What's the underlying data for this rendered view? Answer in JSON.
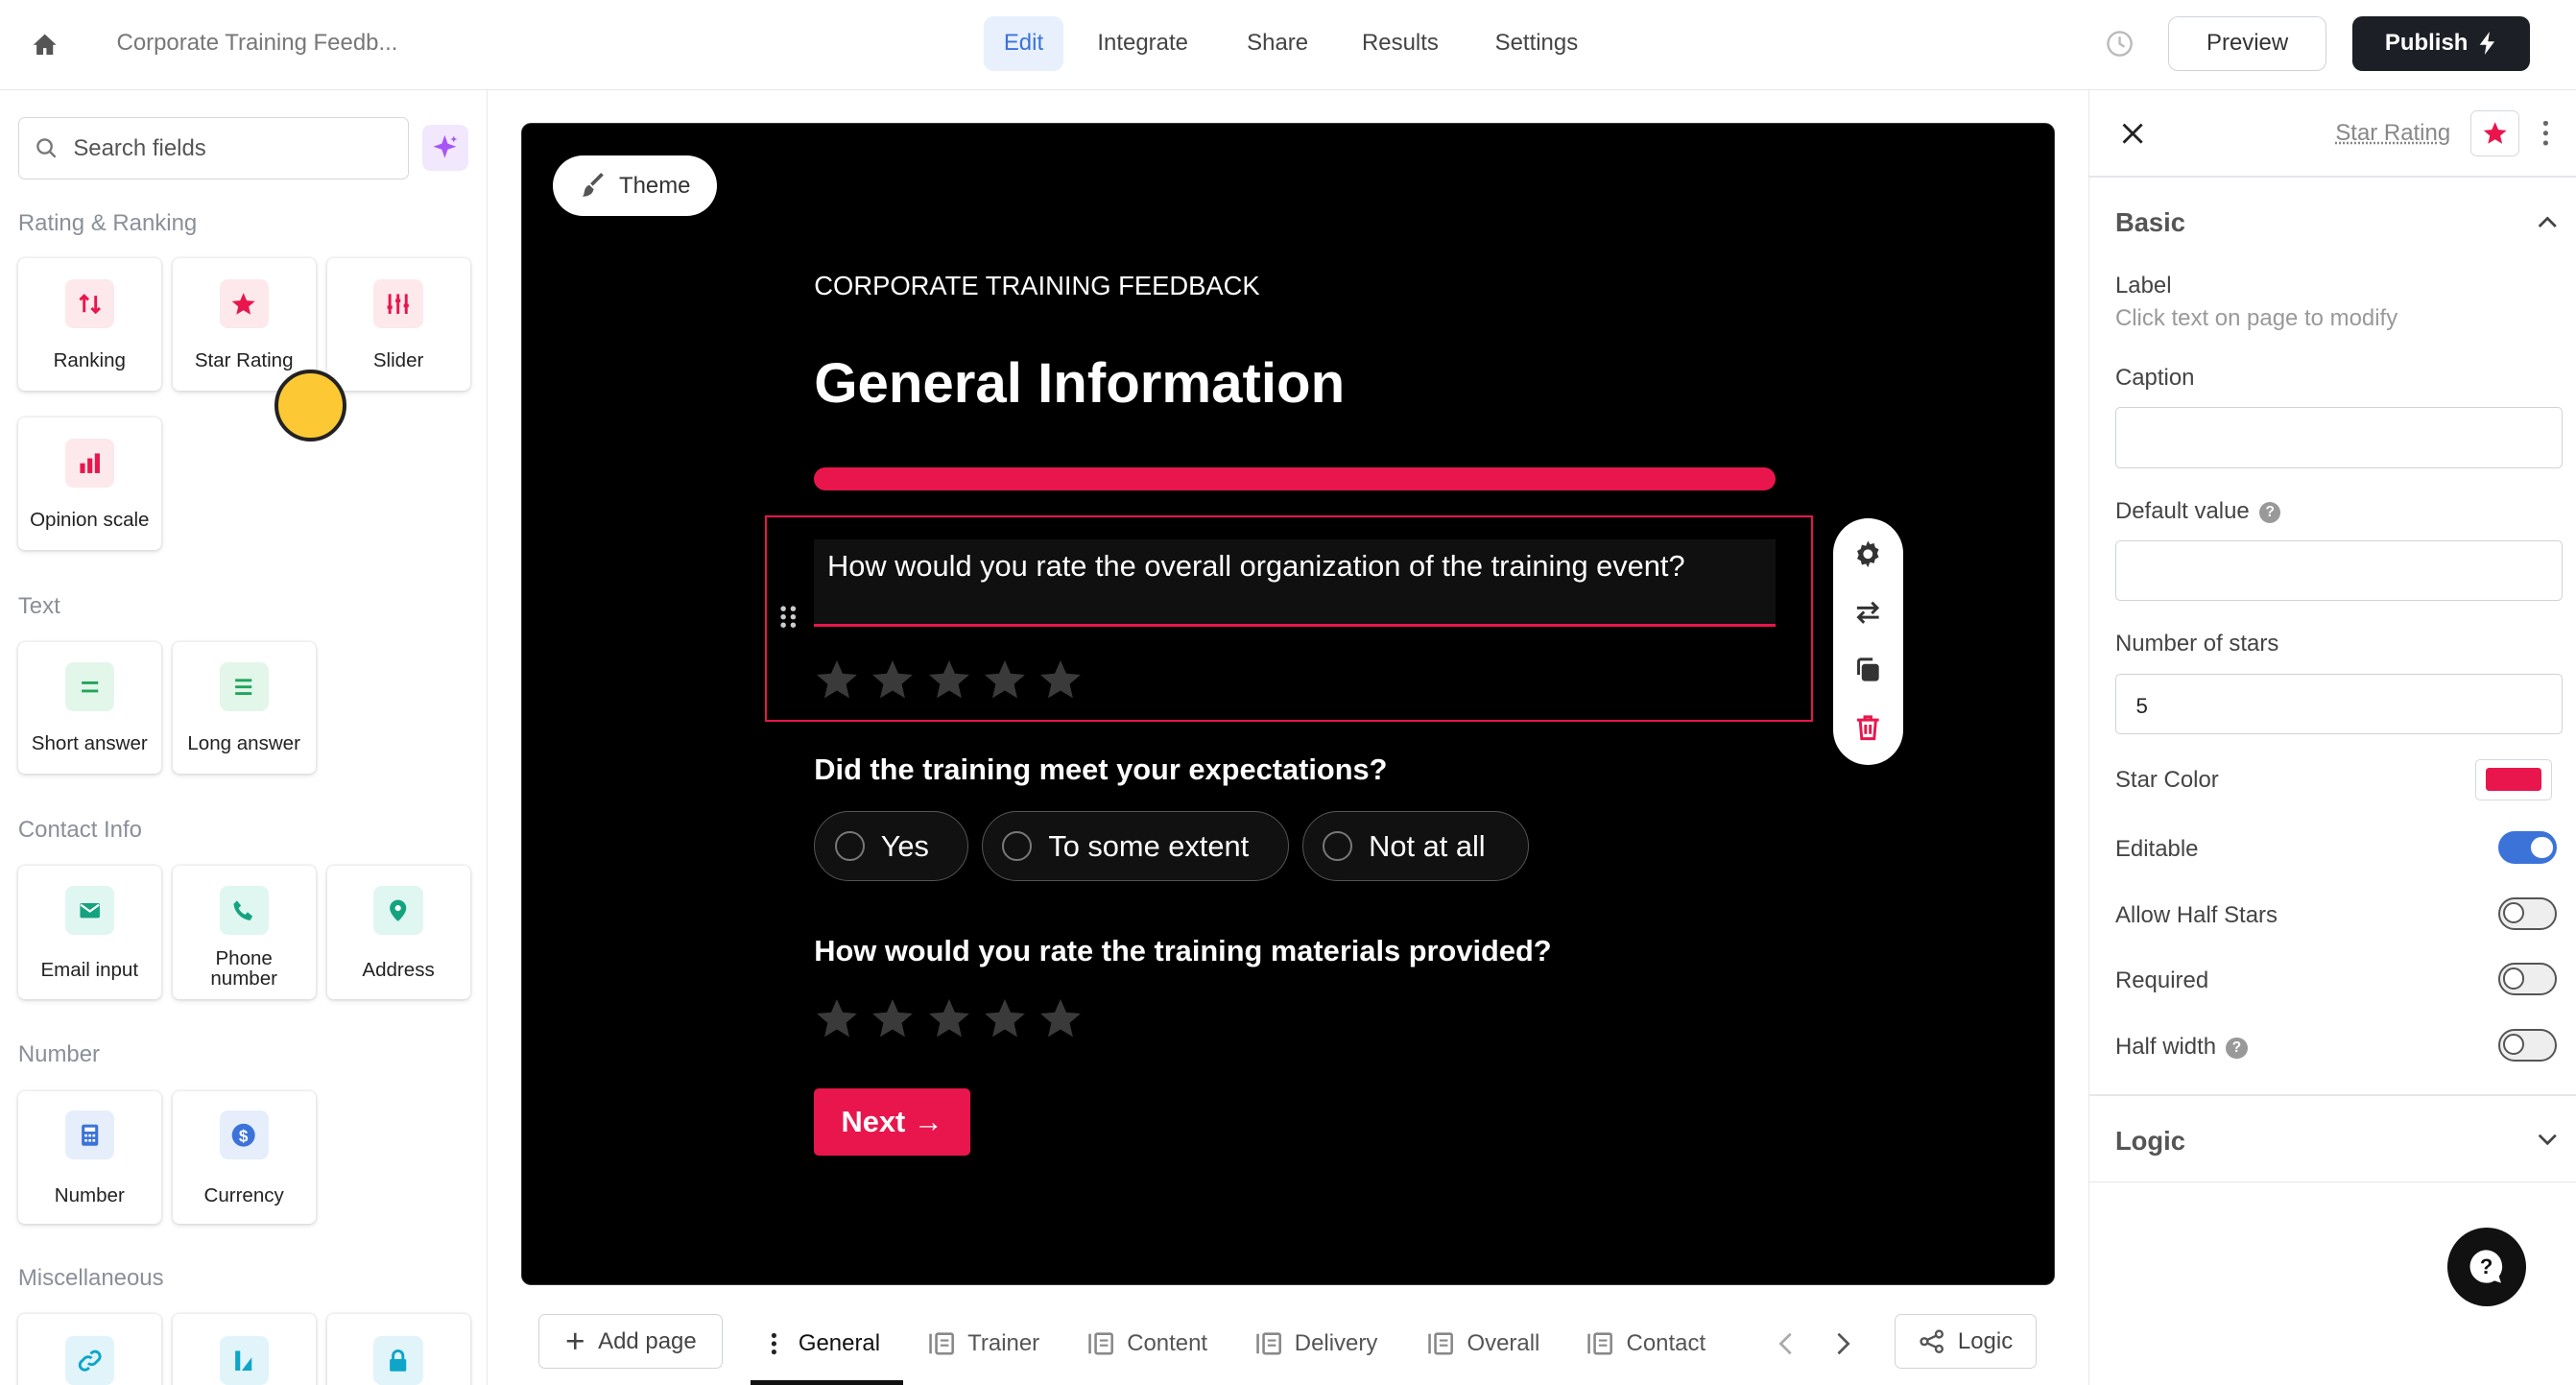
{
  "header": {
    "form_name": "Corporate Training Feedb...",
    "tabs": [
      {
        "label": "Edit",
        "active": true
      },
      {
        "label": "Integrate"
      },
      {
        "label": "Share"
      },
      {
        "label": "Results"
      },
      {
        "label": "Settings"
      }
    ],
    "preview_label": "Preview",
    "publish_label": "Publish"
  },
  "sidebar": {
    "search_placeholder": "Search fields",
    "sections": [
      {
        "title": "Rating & Ranking",
        "items": [
          {
            "label": "Ranking",
            "icon": "ranking-arrows-icon"
          },
          {
            "label": "Star Rating",
            "icon": "star-icon"
          },
          {
            "label": "Slider",
            "icon": "slider-icon"
          },
          {
            "label": "Opinion scale",
            "icon": "bar-chart-icon"
          }
        ]
      },
      {
        "title": "Text",
        "items": [
          {
            "label": "Short answer",
            "icon": "short-text-icon"
          },
          {
            "label": "Long answer",
            "icon": "long-text-icon"
          }
        ]
      },
      {
        "title": "Contact Info",
        "items": [
          {
            "label": "Email input",
            "icon": "email-icon"
          },
          {
            "label": "Phone number",
            "icon": "phone-icon"
          },
          {
            "label": "Address",
            "icon": "location-pin-icon"
          }
        ]
      },
      {
        "title": "Number",
        "items": [
          {
            "label": "Number",
            "icon": "calculator-icon"
          },
          {
            "label": "Currency",
            "icon": "dollar-icon"
          }
        ]
      },
      {
        "title": "Miscellaneous",
        "items": [
          {
            "label": "",
            "icon": "link-icon"
          },
          {
            "label": "",
            "icon": "signature-icon"
          },
          {
            "label": "",
            "icon": "lock-icon"
          }
        ]
      }
    ]
  },
  "canvas": {
    "theme_label": "Theme",
    "form_subtitle": "CORPORATE TRAINING FEEDBACK",
    "page_title": "General Information",
    "progress_fraction": 1.0,
    "questions": [
      {
        "text": "How would you rate the overall organization of the training event?",
        "type": "star-rating",
        "stars": 5
      },
      {
        "text": "Did the training meet your expectations?",
        "type": "choice",
        "options": [
          "Yes",
          "To some extent",
          "Not at all"
        ]
      },
      {
        "text": "How would you rate the training materials provided?",
        "type": "star-rating",
        "stars": 5
      }
    ],
    "next_label": "Next →"
  },
  "pages_bar": {
    "add_page_label": "Add page",
    "pages": [
      {
        "label": "General",
        "active": true
      },
      {
        "label": "Trainer"
      },
      {
        "label": "Content"
      },
      {
        "label": "Delivery"
      },
      {
        "label": "Overall"
      },
      {
        "label": "Contact"
      }
    ],
    "logic_label": "Logic"
  },
  "properties": {
    "field_type": "Star Rating",
    "basic_title": "Basic",
    "label_title": "Label",
    "label_hint": "Click text on page to modify",
    "caption_label": "Caption",
    "caption_value": "",
    "default_value_label": "Default value",
    "default_value": "",
    "number_of_stars_label": "Number of stars",
    "number_of_stars": "5",
    "star_color_label": "Star Color",
    "star_color": "#e8164c",
    "editable_label": "Editable",
    "editable": true,
    "allow_half_label": "Allow Half Stars",
    "allow_half": false,
    "required_label": "Required",
    "required": false,
    "half_width_label": "Half width",
    "half_width": false,
    "logic_title": "Logic"
  },
  "colors": {
    "accent": "#e8164c",
    "primary": "#3b73d9",
    "dark": "#1c1f26"
  }
}
